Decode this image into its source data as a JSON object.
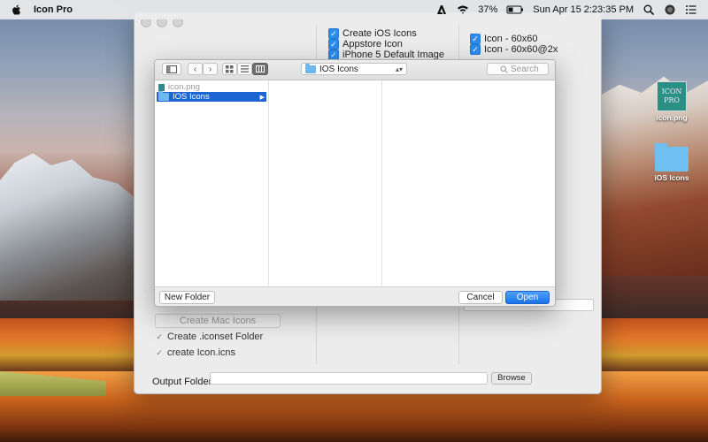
{
  "menubar": {
    "app_name": "Icon Pro",
    "battery_percent": "37%",
    "datetime": "Sun Apr 15  2:23:35 PM"
  },
  "main_window": {
    "options_col1": [
      {
        "label": "Create iOS Icons",
        "checked": true
      },
      {
        "label": "Appstore Icon",
        "checked": true
      },
      {
        "label": "iPhone 5 Default Image",
        "checked": true
      }
    ],
    "options_col2": [
      {
        "label": "Icon - 60x60",
        "checked": true
      },
      {
        "label": "Icon - 60x60@2x",
        "checked": true
      }
    ],
    "create_mac_icons_label": "Create Mac Icons",
    "create_iconset_label": "Create .iconset Folder",
    "create_icns_label": "create Icon.icns",
    "output_folder_label": "Output Folder",
    "output_folder_value": "",
    "browse_label": "Browse"
  },
  "dialog": {
    "location": "IOS Icons",
    "search_placeholder": "Search",
    "column1_items": [
      {
        "label": "icon.png",
        "type": "file",
        "dimmed": true
      },
      {
        "label": "IOS Icons",
        "type": "folder",
        "selected": true
      }
    ],
    "new_folder_label": "New Folder",
    "cancel_label": "Cancel",
    "open_label": "Open"
  },
  "desktop": {
    "items": [
      {
        "label": "icon.png",
        "tile_text": "ICON PRO"
      },
      {
        "label": "iOS Icons"
      }
    ]
  }
}
